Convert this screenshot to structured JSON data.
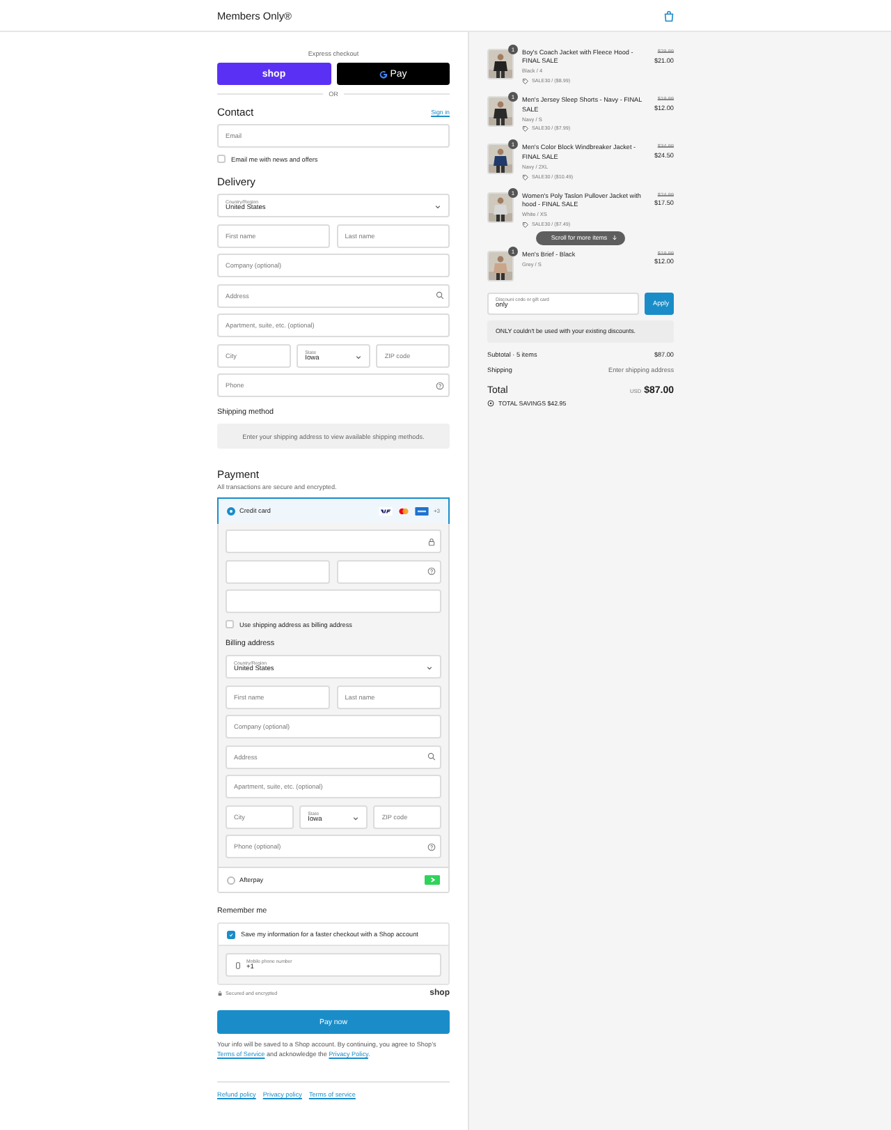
{
  "header": {
    "store_name": "Members Only®"
  },
  "express": {
    "label": "Express checkout",
    "buttons": [
      {
        "kind": "shop",
        "label": "shop"
      },
      {
        "kind": "gpay",
        "label": "Pay"
      }
    ],
    "divider": "OR"
  },
  "contact": {
    "heading": "Contact",
    "link": "Sign in",
    "email": {
      "kind": "email",
      "placeholder": "Email"
    },
    "newsletter": {
      "label": "Email me with news and offers",
      "checked": false
    }
  },
  "delivery": {
    "heading": "Delivery",
    "rows": [
      [
        {
          "kind": "select",
          "label": "Country/Region",
          "value": "United States"
        }
      ],
      [
        {
          "kind": "text",
          "placeholder": "First name"
        },
        {
          "kind": "text",
          "placeholder": "Last name"
        }
      ],
      [
        {
          "kind": "text",
          "placeholder": "Company (optional)"
        }
      ],
      [
        {
          "kind": "address",
          "placeholder": "Address"
        }
      ],
      [
        {
          "kind": "text",
          "placeholder": "Apartment, suite, etc. (optional)"
        }
      ],
      [
        {
          "kind": "text",
          "placeholder": "City"
        },
        {
          "kind": "select",
          "label": "State",
          "value": "Iowa"
        },
        {
          "kind": "text",
          "placeholder": "ZIP code"
        }
      ],
      [
        {
          "kind": "phone",
          "placeholder": "Phone"
        }
      ]
    ]
  },
  "shipping_method": {
    "heading": "Shipping method",
    "notice": "Enter your shipping address to view available shipping methods."
  },
  "payment": {
    "heading": "Payment",
    "subtitle": "All transactions are secure and encrypted.",
    "methods": [
      {
        "kind": "card",
        "label": "Credit card",
        "selected": true,
        "more": "+3"
      },
      {
        "kind": "afterpay",
        "label": "Afterpay",
        "selected": false
      }
    ],
    "card_rows": [
      [
        {
          "kind": "card_number"
        }
      ],
      [
        {
          "kind": "text"
        },
        {
          "kind": "security_code"
        }
      ],
      [
        {
          "kind": "text"
        }
      ]
    ],
    "billing_same": {
      "label": "Use shipping address as billing address",
      "checked": false
    },
    "billing_heading": "Billing address",
    "billing_rows": [
      [
        {
          "kind": "select",
          "label": "Country/Region",
          "value": "United States"
        }
      ],
      [
        {
          "kind": "text",
          "placeholder": "First name"
        },
        {
          "kind": "text",
          "placeholder": "Last name"
        }
      ],
      [
        {
          "kind": "text",
          "placeholder": "Company (optional)"
        }
      ],
      [
        {
          "kind": "address",
          "placeholder": "Address"
        }
      ],
      [
        {
          "kind": "text",
          "placeholder": "Apartment, suite, etc. (optional)"
        }
      ],
      [
        {
          "kind": "text",
          "placeholder": "City"
        },
        {
          "kind": "select",
          "label": "State",
          "value": "Iowa"
        },
        {
          "kind": "text",
          "placeholder": "ZIP code"
        }
      ],
      [
        {
          "kind": "phone",
          "placeholder": "Phone (optional)"
        }
      ]
    ]
  },
  "remember": {
    "heading": "Remember me",
    "save": {
      "label": "Save my information for a faster checkout with a Shop account",
      "checked": true
    },
    "phone": {
      "label": "Mobile phone number",
      "value": "+1"
    },
    "secure": "Secured and encrypted",
    "brand": "shop"
  },
  "pay_button": "Pay now",
  "legal": [
    {
      "kind": "text",
      "text": "Your info will be saved to a Shop account. By continuing, you agree to Shop’s "
    },
    {
      "kind": "link",
      "text": "Terms of Service"
    },
    {
      "kind": "text",
      "text": " and acknowledge the "
    },
    {
      "kind": "link",
      "text": "Privacy Policy"
    },
    {
      "kind": "text",
      "text": "."
    }
  ],
  "footer_links": [
    "Refund policy",
    "Privacy policy",
    "Terms of service"
  ],
  "summary": {
    "items": [
      {
        "title": "Boy's Coach Jacket with Fleece Hood - FINAL SALE",
        "variant": "Black / 4",
        "discount": "SALE30 / ($8.99)",
        "old_price": "$29.99",
        "price": "$21.00",
        "quantity": "1"
      },
      {
        "title": "Men's Jersey Sleep Shorts - Navy - FINAL SALE",
        "variant": "Navy / S",
        "discount": "SALE30 / ($7.99)",
        "old_price": "$19.99",
        "price": "$12.00",
        "quantity": "1"
      },
      {
        "title": "Men's Color Block Windbreaker Jacket - FINAL SALE",
        "variant": "Navy / 2XL",
        "discount": "SALE30 / ($10.49)",
        "old_price": "$34.99",
        "price": "$24.50",
        "quantity": "1"
      },
      {
        "title": "Women's Poly Taslon Pullover Jacket with hood - FINAL SALE",
        "variant": "White / XS",
        "discount": "SALE30 / ($7.49)",
        "old_price": "$24.99",
        "price": "$17.50",
        "quantity": "1"
      },
      {
        "title": "Men's Brief - Black",
        "variant": "Grey / S",
        "old_price": "$19.99",
        "price": "$12.00",
        "quantity": "1"
      }
    ],
    "scroll_hint": "Scroll for more items",
    "discount_field": {
      "label": "Discount code or gift card",
      "value": "only"
    },
    "apply": "Apply",
    "error": "ONLY couldn't be used with your existing discounts.",
    "subtotal": {
      "label": "Subtotal · 5 items",
      "value": "$87.00"
    },
    "shipping": {
      "label": "Shipping",
      "value": "Enter shipping address"
    },
    "total": {
      "label": "Total",
      "currency": "USD",
      "value": "$87.00"
    },
    "savings": "TOTAL SAVINGS $42.95"
  }
}
